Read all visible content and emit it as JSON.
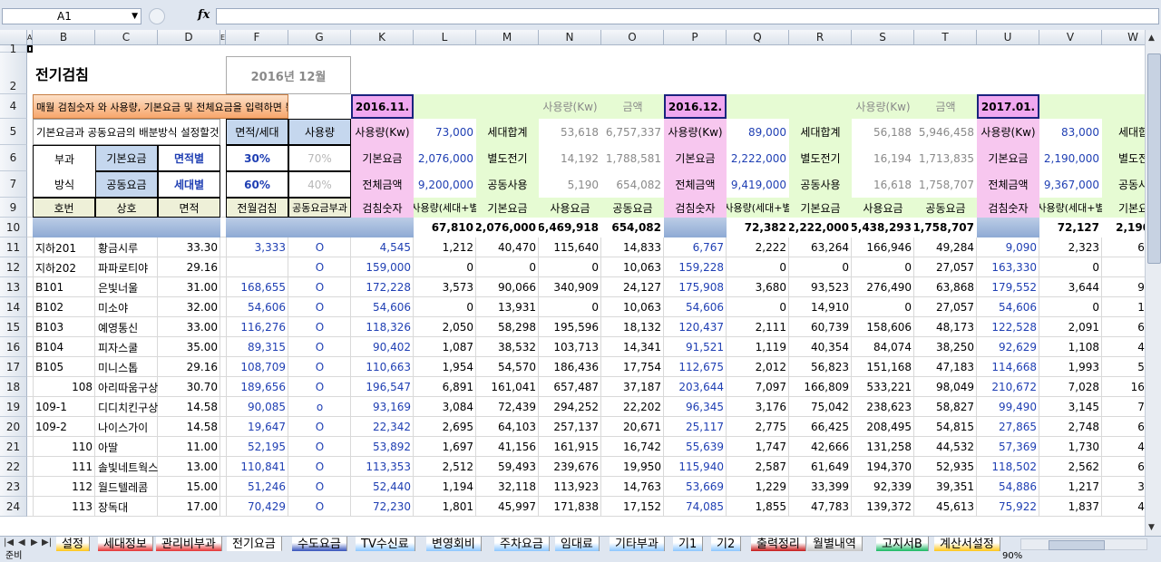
{
  "formula_bar": {
    "name_box": "A1",
    "fx_label": "fx",
    "formula": ""
  },
  "window_hint": "",
  "columns": [
    "A",
    "B",
    "C",
    "D",
    "E",
    "F",
    "G",
    "K",
    "L",
    "M",
    "N",
    "O",
    "P",
    "Q",
    "R",
    "S",
    "T",
    "U",
    "V",
    "W"
  ],
  "row_numbers": [
    "1",
    "2",
    "4",
    "5",
    "6",
    "7",
    "9",
    "10",
    "11",
    "12",
    "13",
    "14",
    "15",
    "16",
    "17",
    "18",
    "19",
    "20",
    "21",
    "22",
    "23",
    "24"
  ],
  "sheet": {
    "title": "전기검침",
    "month_box": "2016년 12월",
    "notice": "매월 검침숫자 와 사용량, 기본요금 및 전체요금을 입력하면 됩니다.",
    "alloc_label": "기본요금과 공동요금의 배분방식 설정할것",
    "alloc_h1": "면적/세대",
    "alloc_h2": "사용량",
    "bugwa": "부과",
    "bangsik": "방식",
    "gibon": "기본요금",
    "gongdong": "공동요금",
    "gibon_mode": "면적별",
    "gongdong_mode": "세대별",
    "gibon_pct": "30%",
    "gibon_use_pct": "70%",
    "gongdong_pct": "60%",
    "gongdong_use_pct": "40%",
    "hdr_hobeon": "호번",
    "hdr_sangho": "상호",
    "hdr_myeonjeok": "면적",
    "hdr_prev": "전월검침",
    "hdr_gongdong_bugwa": "공동요금부과",
    "months": [
      {
        "month": "2016.11.",
        "top_use": "사용량(Kw)",
        "top_amt": "금액",
        "use_lbl": "사용량(Kw)",
        "use_val": "73,000",
        "gibon_lbl": "기본요금",
        "gibon_val": "2,076,000",
        "total_lbl": "전체금액",
        "total_val": "9,200,000",
        "s1_lbl": "세대합계",
        "s1_use": "53,618",
        "s1_amt": "6,757,337",
        "s2_lbl": "별도전기",
        "s2_use": "14,192",
        "s2_amt": "1,788,581",
        "s3_lbl": "공동사용",
        "s3_use": "5,190",
        "s3_amt": "654,082",
        "h_read": "검침숫자",
        "h_use": "사용량(세대+별",
        "h_gibon": "기본요금",
        "h_usefee": "사용요금",
        "h_gongdong": "공동요금",
        "tot_use": "67,810",
        "tot_gibon": "2,076,000",
        "tot_usefee": "6,469,918",
        "tot_gongdong": "654,082"
      },
      {
        "month": "2016.12.",
        "top_use": "사용량(Kw)",
        "top_amt": "금액",
        "use_lbl": "사용량(Kw)",
        "use_val": "89,000",
        "gibon_lbl": "기본요금",
        "gibon_val": "2,222,000",
        "total_lbl": "전체금액",
        "total_val": "9,419,000",
        "s1_lbl": "세대합계",
        "s1_use": "56,188",
        "s1_amt": "5,946,458",
        "s2_lbl": "별도전기",
        "s2_use": "16,194",
        "s2_amt": "1,713,835",
        "s3_lbl": "공동사용",
        "s3_use": "16,618",
        "s3_amt": "1,758,707",
        "h_read": "검침숫자",
        "h_use": "사용량(세대+별",
        "h_gibon": "기본요금",
        "h_usefee": "사용요금",
        "h_gongdong": "공동요금",
        "tot_use": "72,382",
        "tot_gibon": "2,222,000",
        "tot_usefee": "5,438,293",
        "tot_gongdong": "1,758,707"
      },
      {
        "month": "2017.01.",
        "use_lbl": "사용량(Kw)",
        "use_val": "83,000",
        "gibon_lbl": "기본요금",
        "gibon_val": "2,190,000",
        "total_lbl": "전체금액",
        "total_val": "9,367,000",
        "s1_lbl": "세대합",
        "s2_lbl": "별도전",
        "s3_lbl": "공동사",
        "h_read": "검침숫자",
        "h_use": "사용량(세대+별",
        "h_gibon": "기본요",
        "tot_use": "72,127",
        "tot_gibon": "2,190,0"
      }
    ],
    "rows": [
      {
        "hobeon": "지하201",
        "sangho": "황금시루",
        "area": "33.30",
        "prev": "3,333",
        "gd": "O",
        "k": "4,545",
        "l": "1,212",
        "m": "40,470",
        "n": "115,640",
        "o": "14,833",
        "p": "6,767",
        "q": "2,222",
        "r": "63,264",
        "s": "166,946",
        "t": "49,284",
        "u": "9,090",
        "v": "2,323",
        "w": "67,1"
      },
      {
        "hobeon": "지하202",
        "sangho": "파파로티야",
        "area": "29.16",
        "prev": "",
        "gd": "O",
        "k": "159,000",
        "l": "0",
        "m": "0",
        "n": "0",
        "o": "10,063",
        "p": "159,228",
        "q": "0",
        "r": "0",
        "s": "0",
        "t": "27,057",
        "u": "163,330",
        "v": "0",
        "w": ""
      },
      {
        "hobeon": "B101",
        "sangho": "은빛너울",
        "area": "31.00",
        "prev": "168,655",
        "gd": "O",
        "k": "172,228",
        "l": "3,573",
        "m": "90,066",
        "n": "340,909",
        "o": "24,127",
        "p": "175,908",
        "q": "3,680",
        "r": "93,523",
        "s": "276,490",
        "t": "63,868",
        "u": "179,552",
        "v": "3,644",
        "w": "94,0"
      },
      {
        "hobeon": "B102",
        "sangho": "미소야",
        "area": "32.00",
        "prev": "54,606",
        "gd": "O",
        "k": "54,606",
        "l": "0",
        "m": "13,931",
        "n": "0",
        "o": "10,063",
        "p": "54,606",
        "q": "0",
        "r": "14,910",
        "s": "0",
        "t": "27,057",
        "u": "54,606",
        "v": "0",
        "w": "17,1"
      },
      {
        "hobeon": "B103",
        "sangho": "예영통신",
        "area": "33.00",
        "prev": "116,276",
        "gd": "O",
        "k": "118,326",
        "l": "2,050",
        "m": "58,298",
        "n": "195,596",
        "o": "18,132",
        "p": "120,437",
        "q": "2,111",
        "r": "60,739",
        "s": "158,606",
        "t": "48,173",
        "u": "122,528",
        "v": "2,091",
        "w": "62,0"
      },
      {
        "hobeon": "B104",
        "sangho": "피자스쿨",
        "area": "35.00",
        "prev": "89,315",
        "gd": "O",
        "k": "90,402",
        "l": "1,087",
        "m": "38,532",
        "n": "103,713",
        "o": "14,341",
        "p": "91,521",
        "q": "1,119",
        "r": "40,354",
        "s": "84,074",
        "t": "38,250",
        "u": "92,629",
        "v": "1,108",
        "w": "42,2"
      },
      {
        "hobeon": "B105",
        "sangho": "미니스톱",
        "area": "29.16",
        "prev": "108,709",
        "gd": "O",
        "k": "110,663",
        "l": "1,954",
        "m": "54,570",
        "n": "186,436",
        "o": "17,754",
        "p": "112,675",
        "q": "2,012",
        "r": "56,823",
        "s": "151,168",
        "t": "47,183",
        "u": "114,668",
        "v": "1,993",
        "w": "57,9"
      },
      {
        "hobeon": "108",
        "sangho": "아리따움구상",
        "area": "30.70",
        "prev": "189,656",
        "gd": "O",
        "k": "196,547",
        "l": "6,891",
        "m": "161,041",
        "n": "657,487",
        "o": "37,187",
        "p": "203,644",
        "q": "7,097",
        "r": "166,809",
        "s": "533,221",
        "t": "98,049",
        "u": "210,672",
        "v": "7,028",
        "w": "165,7"
      },
      {
        "hobeon": "109-1",
        "sangho": "디디치킨구상",
        "area": "14.58",
        "prev": "90,085",
        "gd": "o",
        "k": "93,169",
        "l": "3,084",
        "m": "72,439",
        "n": "294,252",
        "o": "22,202",
        "p": "96,345",
        "q": "3,176",
        "r": "75,042",
        "s": "238,623",
        "t": "58,827",
        "u": "99,490",
        "v": "3,145",
        "w": "74,6"
      },
      {
        "hobeon": "109-2",
        "sangho": "나이스가이",
        "area": "14.58",
        "prev": "19,647",
        "gd": "O",
        "k": "22,342",
        "l": "2,695",
        "m": "64,103",
        "n": "257,137",
        "o": "20,671",
        "p": "25,117",
        "q": "2,775",
        "r": "66,425",
        "s": "208,495",
        "t": "54,815",
        "u": "27,865",
        "v": "2,748",
        "w": "66,2"
      },
      {
        "hobeon": "110",
        "sangho": "아딸",
        "area": "11.00",
        "prev": "52,195",
        "gd": "O",
        "k": "53,892",
        "l": "1,697",
        "m": "41,156",
        "n": "161,915",
        "o": "16,742",
        "p": "55,639",
        "q": "1,747",
        "r": "42,666",
        "s": "131,258",
        "t": "44,532",
        "u": "57,369",
        "v": "1,730",
        "w": "42,6"
      },
      {
        "hobeon": "111",
        "sangho": "솔빛네트웍스",
        "area": "13.00",
        "prev": "110,841",
        "gd": "O",
        "k": "113,353",
        "l": "2,512",
        "m": "59,493",
        "n": "239,676",
        "o": "19,950",
        "p": "115,940",
        "q": "2,587",
        "r": "61,649",
        "s": "194,370",
        "t": "52,935",
        "u": "118,502",
        "v": "2,562",
        "w": "61,4"
      },
      {
        "hobeon": "112",
        "sangho": "월드텔레콤",
        "area": "15.00",
        "prev": "51,246",
        "gd": "O",
        "k": "52,440",
        "l": "1,194",
        "m": "32,118",
        "n": "113,923",
        "o": "14,763",
        "p": "53,669",
        "q": "1,229",
        "r": "33,399",
        "s": "92,339",
        "t": "39,351",
        "u": "54,886",
        "v": "1,217",
        "w": "33,8"
      },
      {
        "hobeon": "113",
        "sangho": "장독대",
        "area": "17.00",
        "prev": "70,429",
        "gd": "O",
        "k": "72,230",
        "l": "1,801",
        "m": "45,997",
        "n": "171,838",
        "o": "17,152",
        "p": "74,085",
        "q": "1,855",
        "r": "47,783",
        "s": "139,372",
        "t": "45,613",
        "u": "75,922",
        "v": "1,837",
        "w": "48,1"
      }
    ]
  },
  "tabs": [
    {
      "label": "설정",
      "color": "#ffc000"
    },
    {
      "label": "세대정보",
      "color": "#e01b1b"
    },
    {
      "label": "관리비부과",
      "color": "#e01b1b"
    },
    {
      "label": "전기요금",
      "color": "#ffffff"
    },
    {
      "label": "수도요금",
      "color": "#1f3fb3"
    },
    {
      "label": "TV수신료",
      "color": "#7fc0ff"
    },
    {
      "label": "변영회비",
      "color": "#7fc0ff"
    },
    {
      "label": "주차요금",
      "color": "#7fc0ff"
    },
    {
      "label": "임대료",
      "color": "#7fc0ff"
    },
    {
      "label": "기타부과",
      "color": "#7fc0ff"
    },
    {
      "label": "기1",
      "color": "#7fc0ff"
    },
    {
      "label": "기2",
      "color": "#7fc0ff"
    },
    {
      "label": "출력정리",
      "color": "#c00000"
    },
    {
      "label": "월별내역",
      "color": "#bfbfbf"
    },
    {
      "label": "고지서B",
      "color": "#00b050"
    },
    {
      "label": "계산서설정",
      "color": "#ffc000"
    }
  ],
  "status": {
    "ready": "준비",
    "zoom": "90%"
  }
}
